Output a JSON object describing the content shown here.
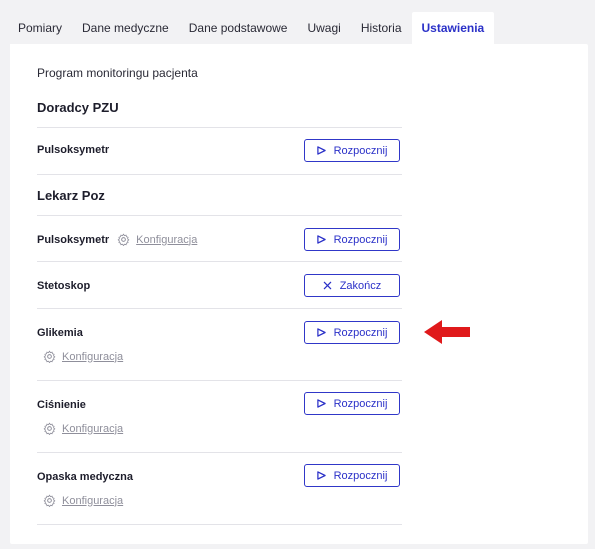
{
  "tabs": [
    {
      "label": "Pomiary",
      "active": false
    },
    {
      "label": "Dane medyczne",
      "active": false
    },
    {
      "label": "Dane podstawowe",
      "active": false
    },
    {
      "label": "Uwagi",
      "active": false
    },
    {
      "label": "Historia",
      "active": false
    },
    {
      "label": "Ustawienia",
      "active": true
    }
  ],
  "panel": {
    "subtitle": "Program monitoringu pacjenta",
    "groups": [
      {
        "title": "Doradcy PZU",
        "devices": [
          {
            "name": "Pulsoksymetr",
            "action_label": "Rozpocznij",
            "action_icon": "play-icon"
          }
        ]
      },
      {
        "title": "Lekarz Poz",
        "devices": [
          {
            "name": "Pulsoksymetr",
            "config_label": "Konfiguracja",
            "action_label": "Rozpocznij",
            "action_icon": "play-icon"
          },
          {
            "name": "Stetoskop",
            "action_label": "Zakończ",
            "action_icon": "close-icon"
          },
          {
            "name": "Glikemia",
            "config_label": "Konfiguracja",
            "action_label": "Rozpocznij",
            "action_icon": "play-icon"
          },
          {
            "name": "Ciśnienie",
            "config_label": "Konfiguracja",
            "action_label": "Rozpocznij",
            "action_icon": "play-icon"
          },
          {
            "name": "Opaska medyczna",
            "config_label": "Konfiguracja",
            "action_label": "Rozpocznij",
            "action_icon": "play-icon"
          }
        ]
      }
    ]
  },
  "colors": {
    "accent": "#2b31c8",
    "annotation_arrow": "#e0191b",
    "muted": "#8f8f9b",
    "background": "#f2f2f4"
  }
}
